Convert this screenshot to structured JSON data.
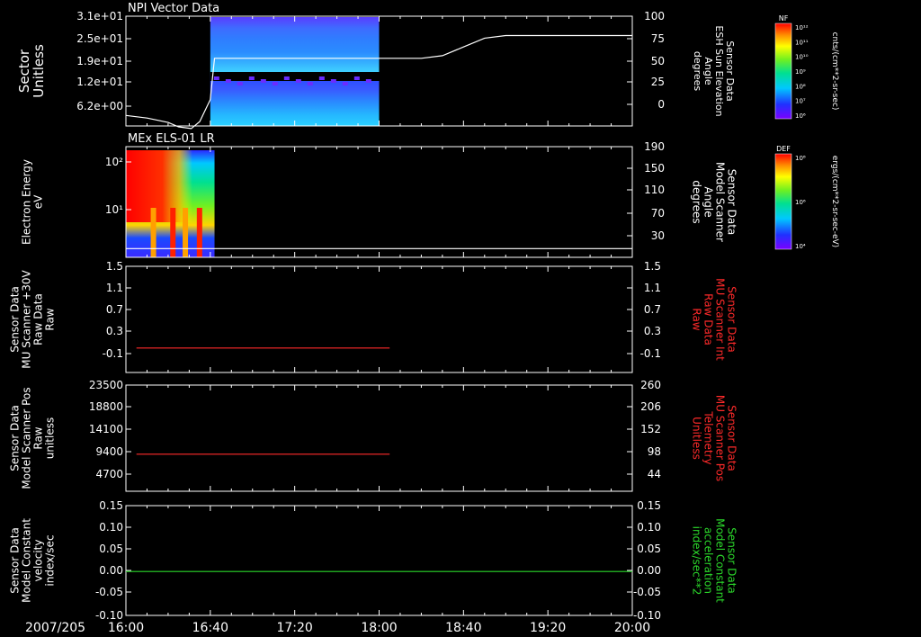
{
  "chart_data": {
    "type": "line",
    "time_axis": {
      "date": "2007/205",
      "ticks": [
        "16:00",
        "16:40",
        "17:20",
        "18:00",
        "18:40",
        "19:20",
        "20:00"
      ],
      "range": [
        "16:00",
        "20:00"
      ]
    },
    "panels": [
      {
        "title": "NPI Vector Data",
        "ylabel_left": [
          "Sector",
          "Unitless"
        ],
        "yticks_left": [
          "3.1e+01",
          "2.5e+01",
          "1.9e+01",
          "1.2e+01",
          "6.2e+00"
        ],
        "ylabel_right": [
          "Sensor Data",
          "ESH Sun Elevation",
          "Angle",
          "degrees"
        ],
        "yticks_right": [
          "100",
          "75",
          "50",
          "25",
          "0"
        ],
        "ylim_right": [
          -25,
          100
        ],
        "spectrogram_span": [
          "16:40",
          "18:00"
        ],
        "colorbar": {
          "label": "NF",
          "ticks": [
            "10¹²",
            "10¹¹",
            "10¹⁰",
            "10⁹",
            "10⁸",
            "10⁷",
            "10⁶"
          ],
          "units": "cnts/(cm**2-sr-sec)"
        },
        "series": [
          {
            "color": "#ffffff",
            "x": [
              "16:00",
              "16:10",
              "16:20",
              "16:25",
              "16:31",
              "16:35",
              "16:40",
              "16:42",
              "17:00",
              "17:20",
              "17:40",
              "18:00",
              "18:20",
              "18:30",
              "18:40",
              "18:50",
              "19:00",
              "19:20",
              "19:40",
              "20:00"
            ],
            "values": [
              -13,
              -16,
              -21,
              -26,
              -28,
              -20,
              5,
              52,
              52,
              52,
              52,
              52,
              52,
              55,
              65,
              75,
              78,
              78,
              78,
              78
            ]
          }
        ]
      },
      {
        "title": "MEx ELS-01 LR",
        "ylabel_left": [
          "Electron Energy",
          "eV"
        ],
        "yticks_left": [
          "10²",
          "10¹"
        ],
        "ylabel_right": [
          "Sensor Data",
          "Model Scanner",
          "Angle",
          "degrees"
        ],
        "yticks_right": [
          "190",
          "150",
          "110",
          "70",
          "30"
        ],
        "ylim_right": [
          0,
          190
        ],
        "spectrogram_span": [
          "16:00",
          "16:42"
        ],
        "colorbar": {
          "label": "DEF",
          "ticks": [
            "10⁸",
            "10⁶",
            "10⁴"
          ],
          "units": "ergs/(cm**2-sr-sec-eV)"
        },
        "series": [
          {
            "color": "#ffffff",
            "x": [
              "16:00",
              "20:00"
            ],
            "values": [
              15,
              15
            ]
          }
        ]
      },
      {
        "ylabel_left": [
          "Sensor Data",
          "MU Scanner +30V",
          "Raw Data",
          "Raw"
        ],
        "yticks_left": [
          "1.5",
          "1.1",
          "0.7",
          "0.3",
          "-0.1"
        ],
        "ylabel_right": [
          "Sensor Data",
          "MU Scanner Int",
          "Raw Data",
          "Raw"
        ],
        "yticks_right": [
          "1.5",
          "1.1",
          "0.7",
          "0.3",
          "-0.1"
        ],
        "ylim": [
          -0.45,
          1.5
        ],
        "series": [
          {
            "color": "#ff2a2a",
            "x": [
              "16:05",
              "18:05"
            ],
            "values": [
              0.0,
              0.0
            ]
          }
        ]
      },
      {
        "ylabel_left": [
          "Sensor Data",
          "Model Scanner Pos",
          "Raw",
          "unitless"
        ],
        "yticks_left": [
          "23500",
          "18800",
          "14100",
          "9400",
          "4700"
        ],
        "ylabel_right": [
          "Sensor Data",
          "MU Scanner Pos",
          "Telemetry",
          "Unitless"
        ],
        "yticks_right": [
          "260",
          "206",
          "152",
          "98",
          "44"
        ],
        "ylim": [
          0,
          23500
        ],
        "series": [
          {
            "color": "#ff2a2a",
            "x": [
              "16:05",
              "18:05"
            ],
            "values": [
              8200,
              8200
            ]
          }
        ]
      },
      {
        "ylabel_left": [
          "Sensor Data",
          "Model Constant",
          "velocity",
          "index/sec"
        ],
        "yticks_left": [
          "0.15",
          "0.10",
          "0.05",
          "0.00",
          "-0.05",
          "-0.10"
        ],
        "ylabel_right": [
          "Sensor Data",
          "Model Constant",
          "acceleration",
          "index/sec**2"
        ],
        "yticks_right": [
          "0.15",
          "0.10",
          "0.05",
          "0.00",
          "-0.05",
          "-0.10"
        ],
        "ylim": [
          -0.1,
          0.15
        ],
        "series": [
          {
            "color": "#2bd92b",
            "x": [
              "16:00",
              "20:00"
            ],
            "values": [
              0.0,
              0.0
            ]
          }
        ]
      }
    ]
  }
}
